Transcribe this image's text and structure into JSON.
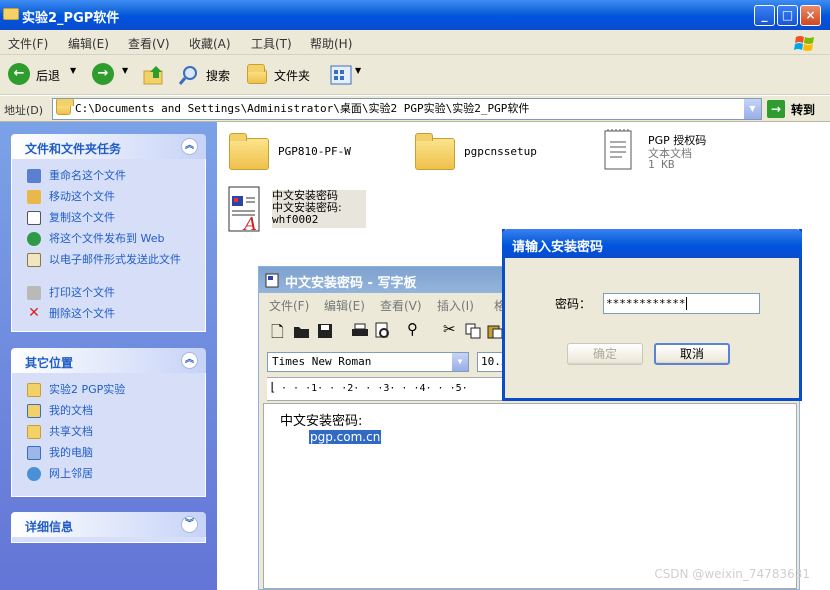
{
  "window": {
    "title": "实验2_PGP软件",
    "controls": {
      "minimize": "_",
      "maximize": "□",
      "close": "×"
    }
  },
  "menubar": {
    "items": [
      "文件(F)",
      "编辑(E)",
      "查看(V)",
      "收藏(A)",
      "工具(T)",
      "帮助(H)"
    ]
  },
  "toolbar": {
    "back": "后退",
    "search": "搜索",
    "folders": "文件夹"
  },
  "addressbar": {
    "label": "地址(D)",
    "path": "C:\\Documents and Settings\\Administrator\\桌面\\实验2 PGP实验\\实验2_PGP软件",
    "go": "转到"
  },
  "taskpane": {
    "file_tasks": {
      "title": "文件和文件夹任务",
      "items": [
        "重命名这个文件",
        "移动这个文件",
        "复制这个文件",
        "将这个文件发布到 Web",
        "以电子邮件形式发送此文件",
        "打印这个文件",
        "删除这个文件"
      ]
    },
    "other_places": {
      "title": "其它位置",
      "items": [
        "实验2 PGP实验",
        "我的文档",
        "共享文档",
        "我的电脑",
        "网上邻居"
      ]
    },
    "details": {
      "title": "详细信息"
    }
  },
  "files": [
    {
      "name": "PGP810-PF-W",
      "kind": "folder"
    },
    {
      "name": "pgpcnssetup",
      "kind": "folder"
    },
    {
      "name": "PGP 授权码",
      "type": "文本文档",
      "size": "1 KB",
      "kind": "text"
    },
    {
      "name_lines": [
        "中文安装密码",
        "中文安装密码:",
        "whf0002"
      ],
      "kind": "wordpad"
    }
  ],
  "wordpad": {
    "title": "中文安装密码 - 写字板",
    "menu": [
      "文件(F)",
      "编辑(E)",
      "查看(V)",
      "插入(I)",
      "格"
    ],
    "font": "Times New Roman",
    "size": "10.5",
    "ruler": "· · ·1· · ·2· · ·3· · ·4· · ·5·",
    "content": {
      "line1": "中文安装密码:",
      "line2": "pgp.com.cn"
    }
  },
  "dialog": {
    "title": "请输入安装密码",
    "label": "密码：",
    "password_mask": "************",
    "ok": "确定",
    "cancel": "取消"
  },
  "watermark": "CSDN @weixin_74783631"
}
